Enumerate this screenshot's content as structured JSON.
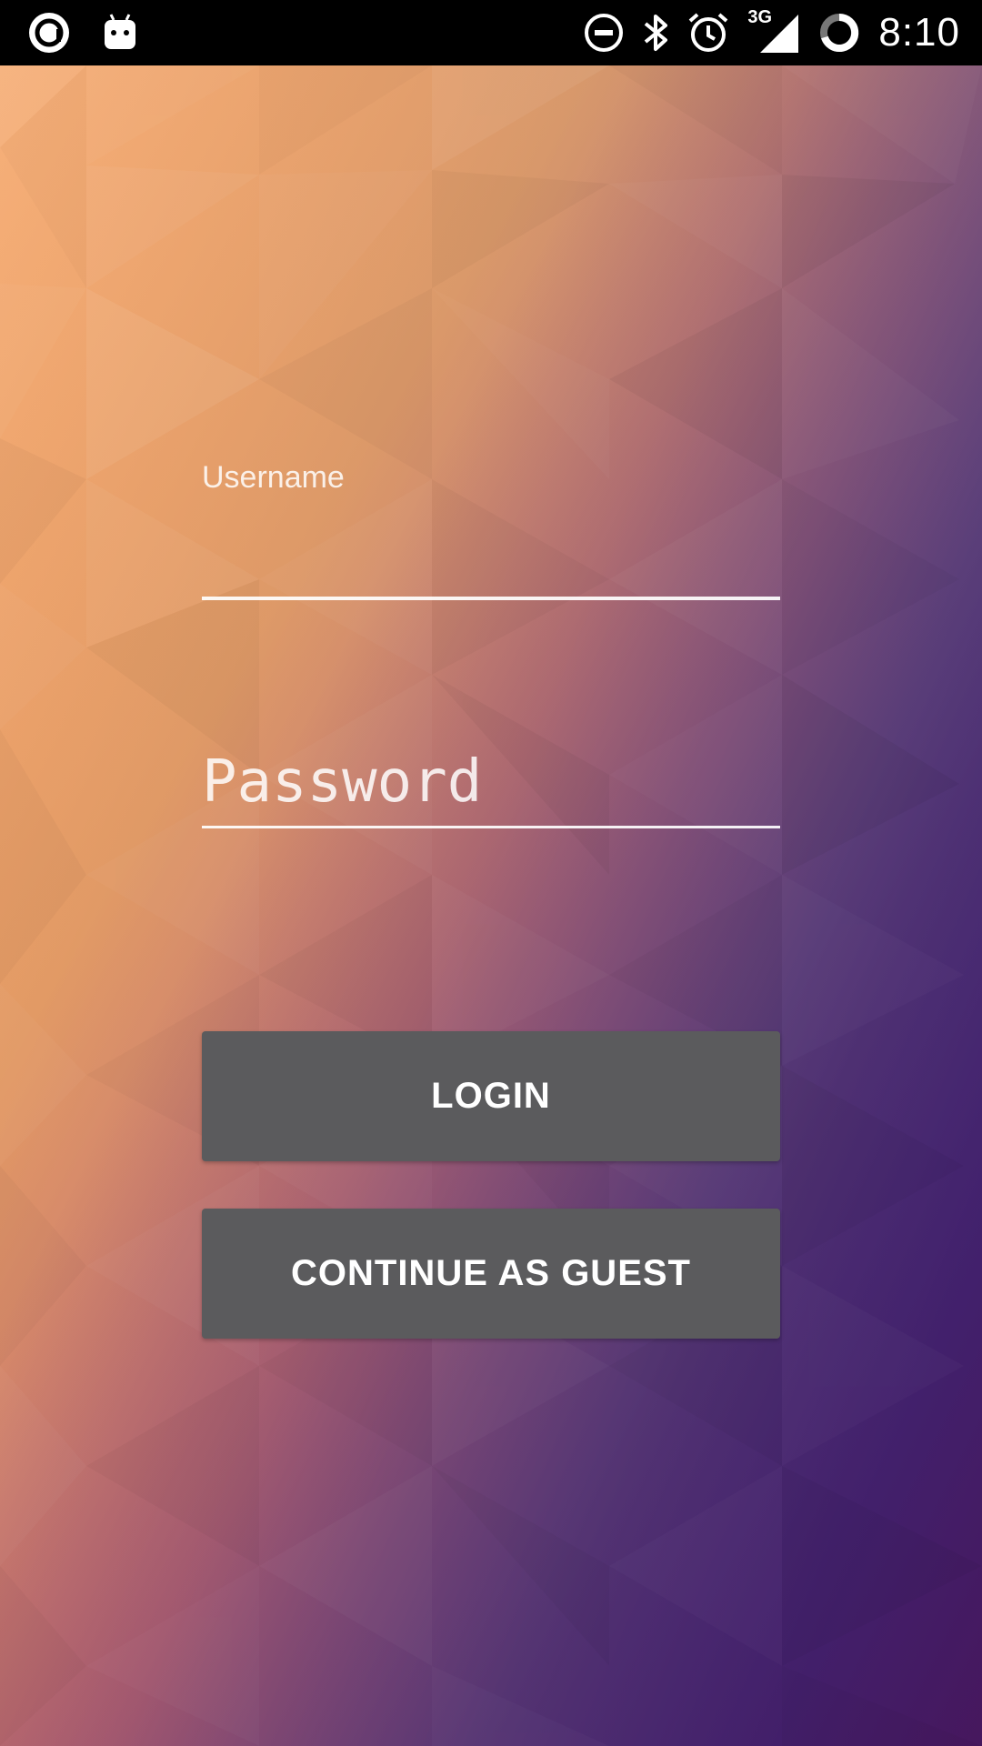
{
  "status_bar": {
    "time": "8:10",
    "network_type": "3G",
    "left_icons": [
      "app-circle-icon",
      "android-robot-icon"
    ],
    "right_icons": [
      "do-not-disturb-icon",
      "bluetooth-icon",
      "alarm-icon",
      "signal-3g-icon",
      "battery-ring-icon"
    ]
  },
  "login_form": {
    "username_label": "Username",
    "username_value": "",
    "password_placeholder": "Password",
    "login_button_label": "LOGIN",
    "guest_button_label": "CONTINUE AS GUEST"
  },
  "colors": {
    "button_background": "#5b5b5d",
    "status_bar_background": "#000000",
    "text": "#ffffff"
  }
}
